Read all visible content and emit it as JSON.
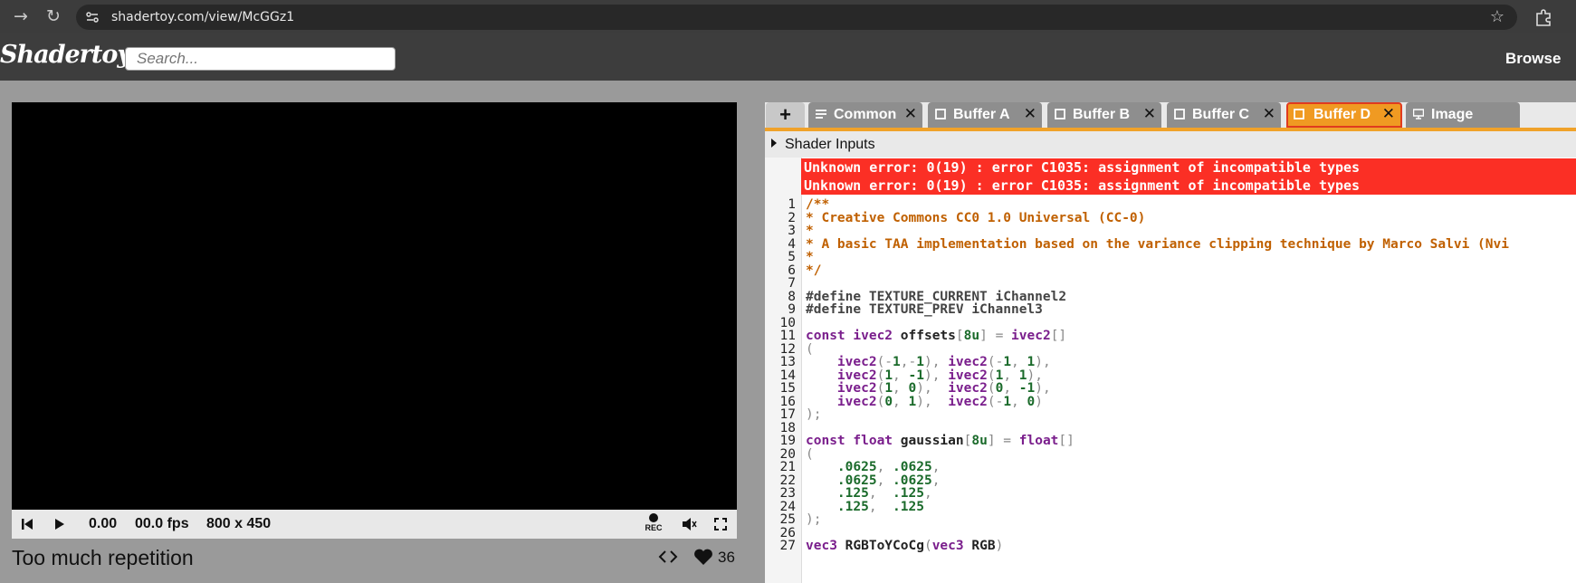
{
  "browser": {
    "url": "shadertoy.com/view/McGGz1"
  },
  "site": {
    "logo": "Shadertoy",
    "search_placeholder": "Search...",
    "browse_label": "Browse"
  },
  "player": {
    "time": "0.00",
    "fps": "00.0 fps",
    "resolution": "800 x 450",
    "rec_label": "REC",
    "title": "Too much repetition",
    "likes": "36"
  },
  "editor": {
    "add_label": "+",
    "tabs": [
      {
        "label": "Common",
        "active": false
      },
      {
        "label": "Buffer A",
        "active": false
      },
      {
        "label": "Buffer B",
        "active": false
      },
      {
        "label": "Buffer C",
        "active": false
      },
      {
        "label": "Buffer D",
        "active": true
      },
      {
        "label": "Image",
        "active": false
      }
    ],
    "inputs_label": "Shader Inputs",
    "errors": [
      "Unknown error: 0(19) : error C1035: assignment of incompatible types",
      "Unknown error: 0(19) : error C1035: assignment of incompatible types"
    ],
    "code_lines": [
      {
        "n": "1",
        "text": "/**"
      },
      {
        "n": "2",
        "text": "* Creative Commons CC0 1.0 Universal (CC-0)"
      },
      {
        "n": "3",
        "text": "*"
      },
      {
        "n": "4",
        "text": "* A basic TAA implementation based on the variance clipping technique by Marco Salvi (Nvi"
      },
      {
        "n": "5",
        "text": "*"
      },
      {
        "n": "6",
        "text": "*/"
      },
      {
        "n": "7",
        "text": ""
      },
      {
        "n": "8",
        "text": "#define TEXTURE_CURRENT iChannel2"
      },
      {
        "n": "9",
        "text": "#define TEXTURE_PREV iChannel3"
      },
      {
        "n": "10",
        "text": ""
      },
      {
        "n": "11",
        "text": "const ivec2 offsets[8u] = ivec2[]"
      },
      {
        "n": "12",
        "text": "("
      },
      {
        "n": "13",
        "text": "    ivec2(-1,-1), ivec2(-1, 1),"
      },
      {
        "n": "14",
        "text": "    ivec2(1, -1), ivec2(1, 1),"
      },
      {
        "n": "15",
        "text": "    ivec2(1, 0),  ivec2(0, -1),"
      },
      {
        "n": "16",
        "text": "    ivec2(0, 1),  ivec2(-1, 0)"
      },
      {
        "n": "17",
        "text": ");"
      },
      {
        "n": "18",
        "text": ""
      },
      {
        "n": "19",
        "text": "const float gaussian[8u] = float[]"
      },
      {
        "n": "20",
        "text": "("
      },
      {
        "n": "21",
        "text": "    .0625, .0625,"
      },
      {
        "n": "22",
        "text": "    .0625, .0625,"
      },
      {
        "n": "23",
        "text": "    .125,  .125,"
      },
      {
        "n": "24",
        "text": "    .125,  .125"
      },
      {
        "n": "25",
        "text": ");"
      },
      {
        "n": "26",
        "text": ""
      },
      {
        "n": "27",
        "text": "vec3 RGBToYCoCg(vec3 RGB)"
      }
    ]
  },
  "colors": {
    "accent_orange": "#f09a22",
    "error_red": "#fb2f25",
    "active_tab_border": "#e03b1e"
  },
  "icons": [
    "back-icon",
    "reload-icon",
    "site-info-icon",
    "star-icon",
    "extensions-icon",
    "rewind-icon",
    "play-icon",
    "record-icon",
    "mute-icon",
    "fullscreen-icon",
    "code-icon",
    "heart-icon",
    "tab-icon",
    "close-icon",
    "disclosure-icon"
  ]
}
